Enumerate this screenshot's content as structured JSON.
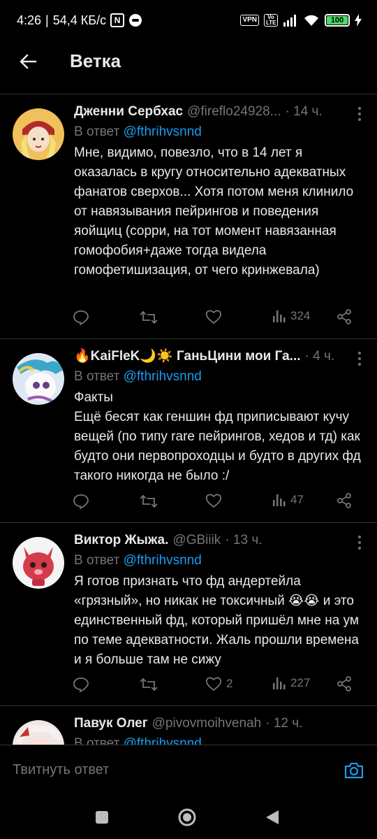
{
  "status_bar": {
    "time": "4:26",
    "speed": "54,4 КБ/с",
    "vpn": "VPN",
    "volte": "Vo LTE",
    "battery": "100"
  },
  "header": {
    "title": "Ветка"
  },
  "tweets": [
    {
      "name": "Дженни Сербхас",
      "handle": "@fireflo24928...",
      "time": "· 14 ч.",
      "reply_prefix": "В ответ ",
      "reply_to": "@fthrihvsnnd",
      "text": "Мне, видимо, повезло, что в 14 лет я оказалась в кругу относительно адекватных фанатов сверхов... Хотя потом меня клинило от навязывания пейрингов и поведения яойщиц (сорри, на тот момент навязанная гомофобия+даже тогда видела гомофетишизация, от чего кринжевала)",
      "likes": "",
      "views": "324"
    },
    {
      "name": "🔥KaiFleK🌙☀️ ГаньЦини мои Га...",
      "handle": "",
      "time": "· 4 ч.",
      "reply_prefix": "В ответ ",
      "reply_to": "@fthrihvsnnd",
      "text": "Факты\nЕщё бесят как геншин фд приписывают кучу вещей (по типу rare пейрингов, хедов и тд) как будто они первопроходцы и будто в других фд такого никогда не было :/",
      "likes": "",
      "views": "47"
    },
    {
      "name": "Виктор Жыжа.",
      "handle": "@GBiiik",
      "time": "· 13 ч.",
      "reply_prefix": "В ответ ",
      "reply_to": "@fthrihvsnnd",
      "text": "Я готов признать что фд андертейла «грязный», но никак не токсичный 😭😭 и это единственный фд, который пришёл мне на ум по теме адекватности. Жаль прошли времена и я больше там не сижу",
      "likes": "2",
      "views": "227"
    },
    {
      "name": "Павук Олег",
      "handle": "@pivovmoihvenah",
      "time": "· 12 ч.",
      "reply_prefix": "В ответ ",
      "reply_to": "@fthrihvsnnd",
      "text": "",
      "likes": "",
      "views": ""
    }
  ],
  "reply_bar": {
    "placeholder": "Твитнуть ответ",
    "icon": "camera-icon"
  },
  "nav_icons": [
    "recents-icon",
    "home-icon",
    "back-icon"
  ],
  "colors": {
    "accent": "#1d9bf0",
    "muted": "#71767b",
    "text": "#e7e9ea",
    "divider": "#2f3336"
  }
}
